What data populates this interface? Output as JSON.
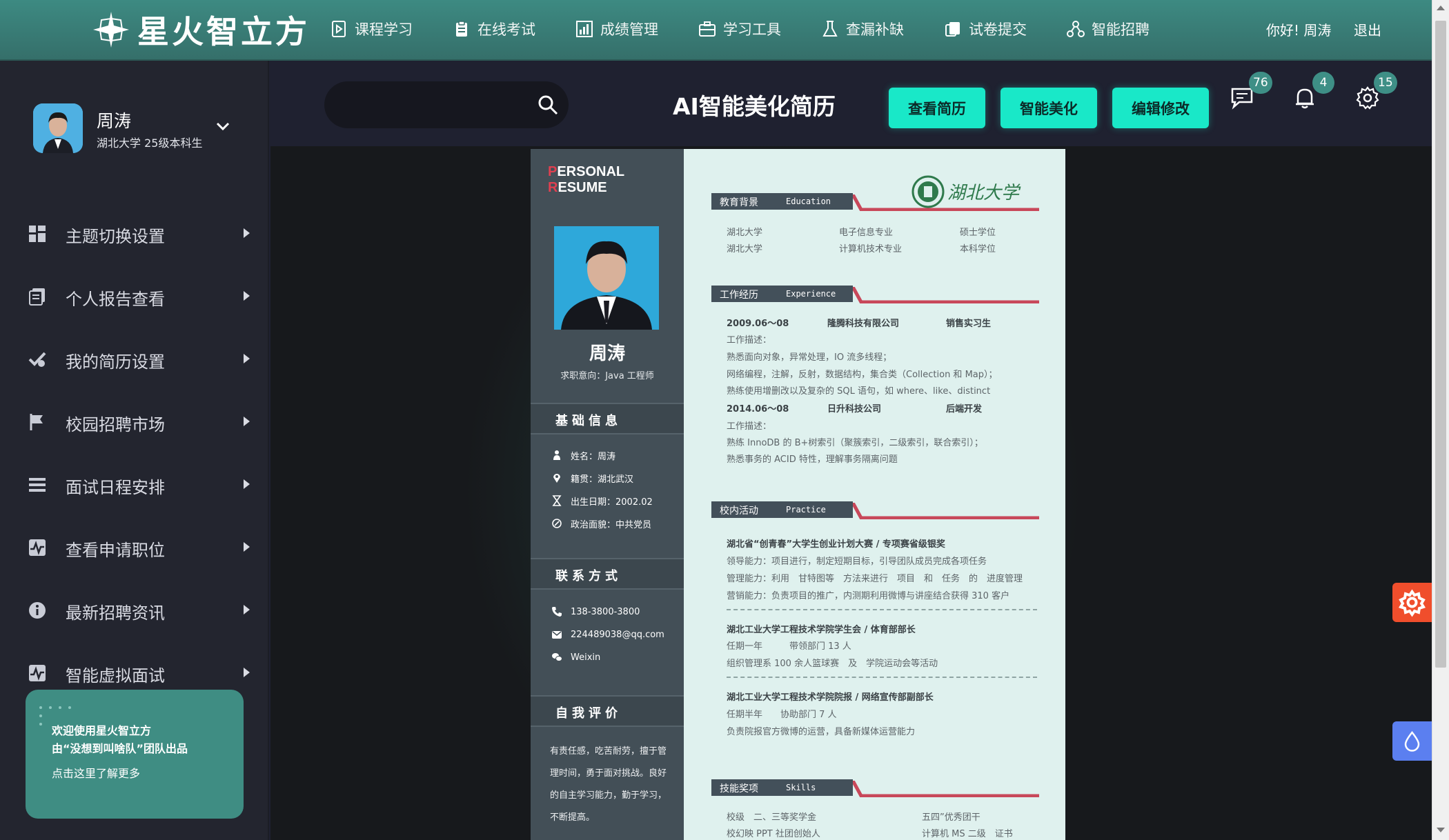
{
  "app": {
    "logo_text": "星火智立方"
  },
  "nav": {
    "items": [
      {
        "label": "课程学习",
        "icon": "play-doc-icon"
      },
      {
        "label": "在线考试",
        "icon": "clipboard-icon"
      },
      {
        "label": "成绩管理",
        "icon": "bar-chart-icon"
      },
      {
        "label": "学习工具",
        "icon": "toolbox-icon"
      },
      {
        "label": "查漏补缺",
        "icon": "flask-icon"
      },
      {
        "label": "试卷提交",
        "icon": "submit-icon"
      },
      {
        "label": "智能招聘",
        "icon": "network-icon"
      }
    ],
    "greeting": "你好! 周涛",
    "logout": "退出"
  },
  "user": {
    "name": "周涛",
    "subtitle": "湖北大学 25级本科生"
  },
  "sidebar": {
    "items": [
      {
        "label": "主题切换设置",
        "icon": "grid-icon"
      },
      {
        "label": "个人报告查看",
        "icon": "report-icon"
      },
      {
        "label": "我的简历设置",
        "icon": "resume-tools-icon"
      },
      {
        "label": "校园招聘市场",
        "icon": "flag-icon"
      },
      {
        "label": "面试日程安排",
        "icon": "list-icon"
      },
      {
        "label": "查看申请职位",
        "icon": "activity-icon"
      },
      {
        "label": "最新招聘资讯",
        "icon": "info-icon"
      },
      {
        "label": "智能虚拟面试",
        "icon": "activity-icon"
      }
    ],
    "promo": {
      "line1": "欢迎使用星火智立方",
      "line2": "由“没想到叫啥队”团队出品",
      "link": "点击这里了解更多"
    }
  },
  "header": {
    "search_placeholder": "",
    "title": "AI智能美化简历",
    "buttons": [
      "查看简历",
      "智能美化",
      "编辑修改"
    ],
    "badges": {
      "messages": "76",
      "notifications": "4",
      "settings": "15"
    }
  },
  "resume": {
    "title_p": "P",
    "title_rest1": "ERSONAL ",
    "title_r": "R",
    "title_rest2": "ESUME",
    "name": "周涛",
    "intent": "求职意向：Java 工程师",
    "sections": {
      "basic": "基础信息",
      "contact": "联系方式",
      "self": "自我评价"
    },
    "basic_info": [
      {
        "text": "姓名：周涛",
        "icon": "person-icon"
      },
      {
        "text": "籍贯：湖北武汉",
        "icon": "location-icon"
      },
      {
        "text": "出生日期：2002.02",
        "icon": "hourglass-icon"
      },
      {
        "text": "政治面貌：中共党员",
        "icon": "party-icon"
      }
    ],
    "contact": [
      {
        "text": "138-3800-3800",
        "icon": "phone-icon"
      },
      {
        "text": "224489038@qq.com",
        "icon": "mail-icon"
      },
      {
        "text": "Weixin",
        "icon": "wechat-icon"
      }
    ],
    "self_eval": "有责任感，吃苦耐劳，擅于管理时间，勇于面对挑战。良好的自主学习能力，勤于学习，不断提高。",
    "school_logo": "湖北大学",
    "right_sections": [
      {
        "cn": "教育背景",
        "en": "Education"
      },
      {
        "cn": "工作经历",
        "en": "Experience"
      },
      {
        "cn": "校内活动",
        "en": "Practice"
      },
      {
        "cn": "技能奖项",
        "en": "Skills"
      }
    ],
    "education": [
      [
        "湖北大学",
        "电子信息专业",
        "硕士学位"
      ],
      [
        "湖北大学",
        "计算机技术专业",
        "本科学位"
      ]
    ],
    "experience": [
      {
        "date": "2009.06～08",
        "company": "隆腾科技有限公司",
        "role": "销售实习生",
        "lines": [
          "工作描述：",
          "熟悉面向对象，异常处理，IO 流多线程；",
          "网络编程，注解，反射，数据结构，集合类（Collection 和 Map）；",
          "熟练使用增删改以及复杂的 SQL 语句，如 where、like、distinct"
        ]
      },
      {
        "date": "2014.06～08",
        "company": "日升科技公司",
        "role": "后端开发",
        "lines": [
          "工作描述：",
          "熟练 InnoDB 的 B+树索引（聚簇索引，二级索引，联合索引）；",
          "熟悉事务的 ACID 特性，理解事务隔离问题"
        ]
      }
    ],
    "practice": [
      {
        "title": "湖北省“创青春”大学生创业计划大赛 / 专项赛省级银奖",
        "lines": [
          "领导能力：项目进行，制定短期目标，引导团队成员完成各项任务",
          "管理能力：利用　甘特图等　方法来进行　项目　和　任务　的　进度管理",
          "营销能力：负责项目的推广，内测期利用微博与讲座结合获得 310 客户"
        ]
      },
      {
        "title": "湖北工业大学工程技术学院学生会 / 体育部部长",
        "lines": [
          "任期一年　　　带领部门 13 人",
          "组织管理系 100 余人篮球赛　及　学院运动会等活动"
        ]
      },
      {
        "title": "湖北工业大学工程技术学院院报 / 网络宣传部副部长",
        "lines": [
          "任期半年　　协助部门 7 人",
          "负责院报官方微博的运营，具备新媒体运营能力"
        ]
      }
    ],
    "skills": [
      [
        "校级　二、三等奖学金",
        "五四”优秀团干"
      ],
      [
        "校幻映 PPT 社团创始人",
        "计算机 MS 二级　证书"
      ]
    ]
  },
  "colors": {
    "topbar": "#3d8a82",
    "accent_button": "#19e8c8",
    "sidebar": "#23252f",
    "resume_red": "#c8485a"
  }
}
